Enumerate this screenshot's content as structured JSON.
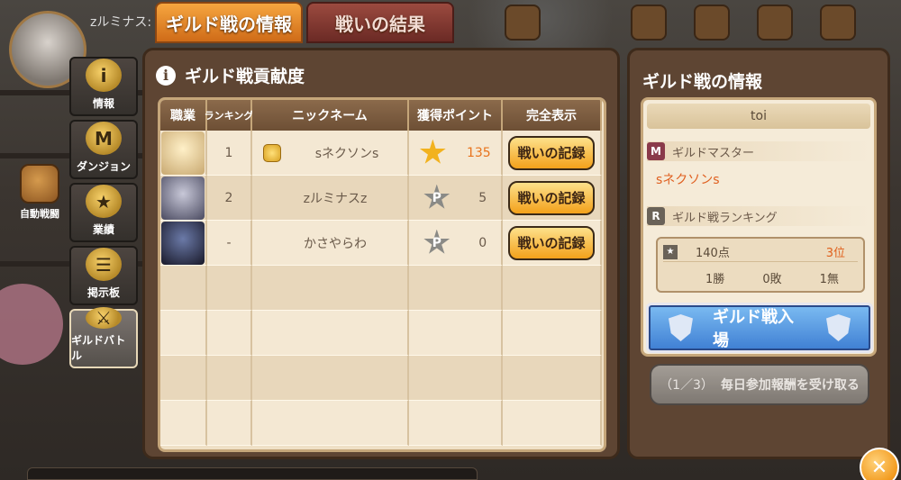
{
  "player": {
    "name": "zルミナス:"
  },
  "tabs": [
    {
      "label": "ギルド戦の情報",
      "active": true
    },
    {
      "label": "戦いの結果",
      "active": false
    }
  ],
  "side_nav": {
    "items": [
      {
        "label": "情報",
        "icon": "i"
      },
      {
        "label": "ダンジョン",
        "icon": "M"
      },
      {
        "label": "業績",
        "icon": "★"
      },
      {
        "label": "掲示板",
        "icon": "☰"
      },
      {
        "label": "ギルドバトル",
        "icon": "⚔"
      }
    ],
    "auto_battle": "自動戦闘"
  },
  "contribution": {
    "title": "ギルド戦貢献度",
    "headers": [
      "職業",
      "ランキング",
      "ニックネーム",
      "獲得ポイント",
      "完全表示"
    ],
    "rows": [
      {
        "rank": "1",
        "nickname": "sネクソンs",
        "points": "135",
        "point_icon": "gold",
        "button": "戦いの記録"
      },
      {
        "rank": "2",
        "nickname": "zルミナスz",
        "points": "5",
        "point_icon": "P",
        "button": "戦いの記録"
      },
      {
        "rank": "-",
        "nickname": "かさやらわ",
        "points": "0",
        "point_icon": "P",
        "button": "戦いの記録"
      }
    ]
  },
  "guild_info": {
    "title": "ギルド戦の情報",
    "guild_name": "toi",
    "master_label": "ギルドマスター",
    "master_name": "sネクソンs",
    "ranking_label": "ギルド戦ランキング",
    "points": "140点",
    "position": "3位",
    "wins": "1勝",
    "losses": "0敗",
    "draws": "1無",
    "enter_button": "ギルド戦入場",
    "daily_count": "（1／3）",
    "daily_button": "毎日参加報酬を受け取る"
  },
  "colors": {
    "accent": "#f3a11b",
    "panel": "#5e4533",
    "enter_blue": "#3e7ed3"
  }
}
